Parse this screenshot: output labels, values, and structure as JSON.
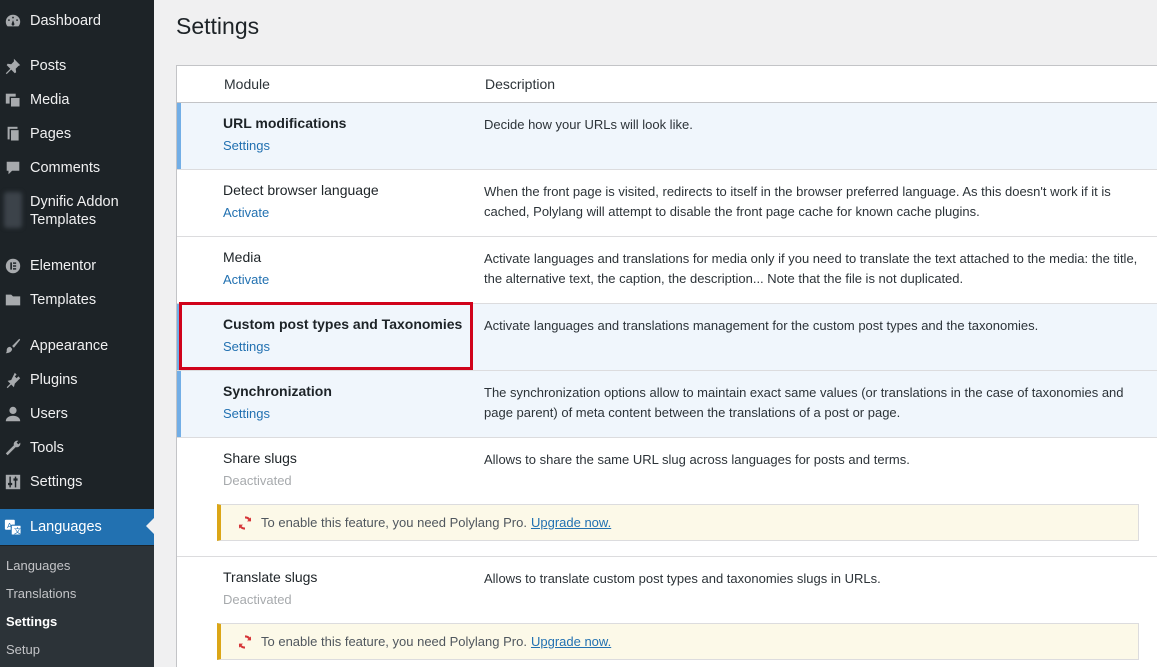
{
  "sidebar": {
    "items": [
      {
        "label": "Dashboard",
        "icon": "dashboard-icon"
      },
      {
        "label": "Posts",
        "icon": "pushpin-icon"
      },
      {
        "label": "Media",
        "icon": "media-icon"
      },
      {
        "label": "Pages",
        "icon": "pages-icon"
      },
      {
        "label": "Comments",
        "icon": "comment-icon"
      },
      {
        "label": "Dynific Addon Templates",
        "icon": "blurred-icon"
      },
      {
        "label": "Elementor",
        "icon": "elementor-icon"
      },
      {
        "label": "Templates",
        "icon": "folder-icon"
      },
      {
        "label": "Appearance",
        "icon": "brush-icon"
      },
      {
        "label": "Plugins",
        "icon": "plugin-icon"
      },
      {
        "label": "Users",
        "icon": "user-icon"
      },
      {
        "label": "Tools",
        "icon": "wrench-icon"
      },
      {
        "label": "Settings",
        "icon": "sliders-icon"
      },
      {
        "label": "Languages",
        "icon": "translation-icon"
      }
    ],
    "submenu": [
      "Languages",
      "Translations",
      "Settings",
      "Setup"
    ],
    "active_submenu": "Settings"
  },
  "page": {
    "title": "Settings"
  },
  "table": {
    "headers": {
      "module": "Module",
      "description": "Description"
    },
    "rows": [
      {
        "title": "URL modifications",
        "action": "Settings",
        "description": "Decide how your URLs will look like.",
        "active": true
      },
      {
        "title": "Detect browser language",
        "action": "Activate",
        "description": "When the front page is visited, redirects to itself in the browser preferred language. As this doesn't work if it is cached, Polylang will attempt to disable the front page cache for known cache plugins.",
        "active": false
      },
      {
        "title": "Media",
        "action": "Activate",
        "description": "Activate languages and translations for media only if you need to translate the text attached to the media: the title, the alternative text, the caption, the description... Note that the file is not duplicated.",
        "active": false
      },
      {
        "title": "Custom post types and Taxonomies",
        "action": "Settings",
        "description": "Activate languages and translations management for the custom post types and the taxonomies.",
        "active": true
      },
      {
        "title": "Synchronization",
        "action": "Settings",
        "description": "The synchronization options allow to maintain exact same values (or translations in the case of taxonomies and page parent) of meta content between the translations of a post or page.",
        "active": true
      },
      {
        "title": "Share slugs",
        "action": "Deactivated",
        "description": "Allows to share the same URL slug across languages for posts and terms.",
        "active": false
      },
      {
        "title": "Translate slugs",
        "action": "Deactivated",
        "description": "Allows to translate custom post types and taxonomies slugs in URLs.",
        "active": false
      }
    ],
    "notice": {
      "text": "To enable this feature, you need Polylang Pro.",
      "link": "Upgrade now.",
      "icon": "refresh-icon"
    }
  },
  "colors": {
    "accent": "#2271b1",
    "highlight": "#d0021b",
    "notice_border": "#dba617"
  }
}
